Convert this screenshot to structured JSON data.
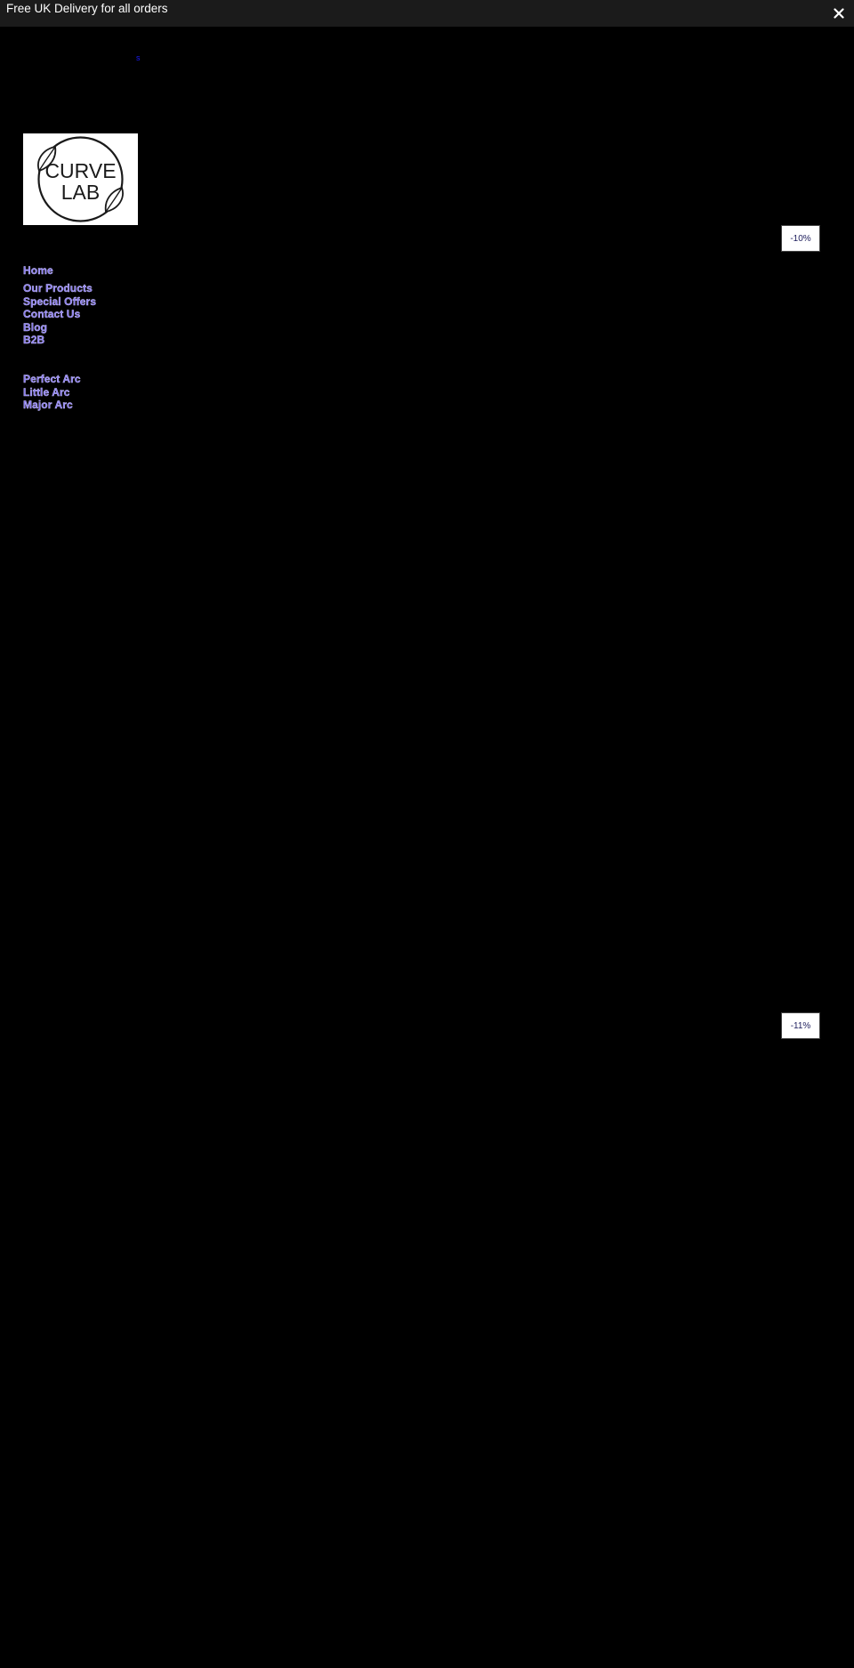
{
  "announcement": {
    "text": "Free UK Delivery for all orders",
    "close_icon": "close-icon"
  },
  "skip_link": {
    "text": "s"
  },
  "logo": {
    "line1": "CURVE",
    "line2": "LAB",
    "icon": "leaf-icon"
  },
  "nav": {
    "home": "Home",
    "items": [
      {
        "label": "Our Products"
      },
      {
        "label": "Special Offers"
      },
      {
        "label": "Contact Us"
      },
      {
        "label": "Blog"
      },
      {
        "label": "B2B"
      }
    ],
    "products": [
      {
        "label": "Perfect Arc"
      },
      {
        "label": "Little Arc"
      },
      {
        "label": "Major Arc"
      }
    ]
  },
  "badges": [
    {
      "label": "-10%"
    },
    {
      "label": "-11%"
    }
  ],
  "colors": {
    "background": "#000000",
    "announcement_bg": "#1b1b1b",
    "nav_link": "#8a7cf0",
    "badge_text": "#1d1d5c"
  }
}
